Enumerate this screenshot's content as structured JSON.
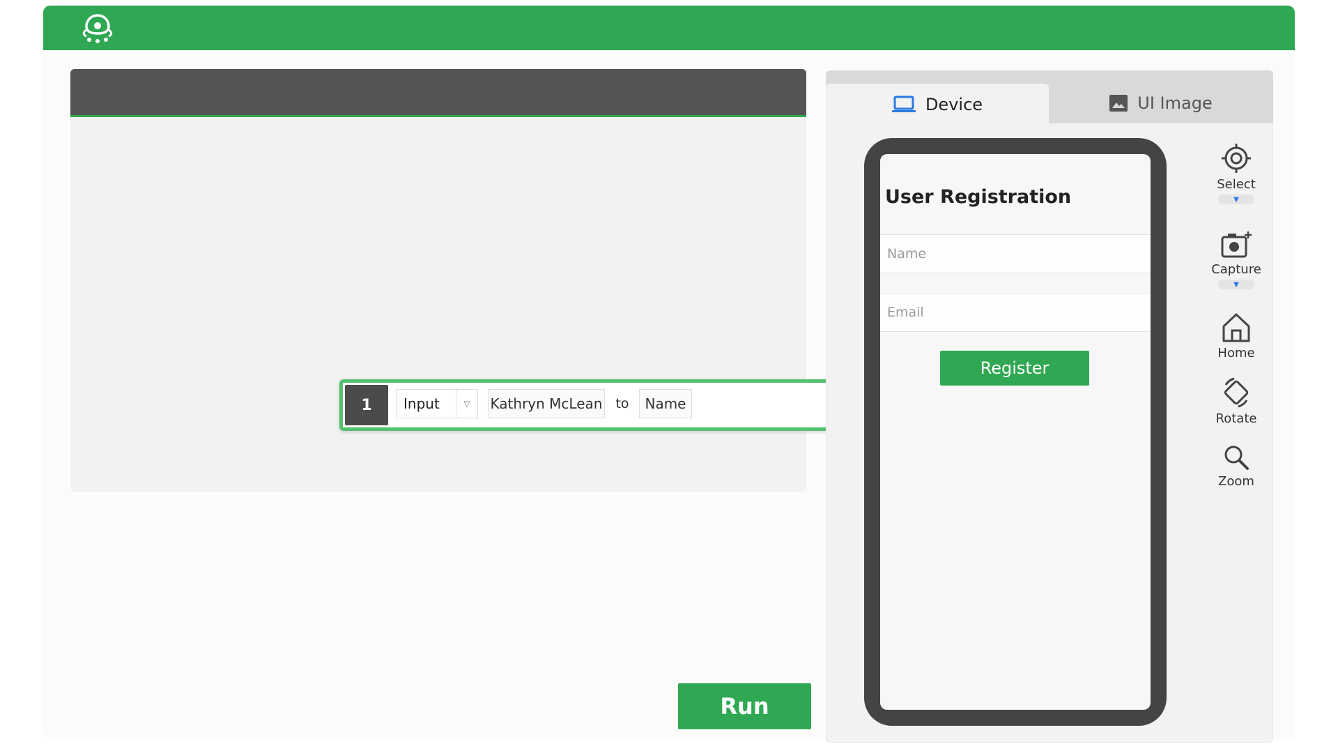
{
  "app": {
    "logo_icon": "robot-ufo-icon",
    "brand_color": "#30a853"
  },
  "step": {
    "number": "1",
    "action": "Input",
    "value": "Kathryn McLean",
    "connector": "to",
    "target": "Name"
  },
  "run_label": "Run",
  "tabs": {
    "device": {
      "label": "Device",
      "icon": "laptop-icon"
    },
    "ui_image": {
      "label": "UI Image",
      "icon": "image-icon"
    }
  },
  "device_screen": {
    "title": "User Registration",
    "name_placeholder": "Name",
    "email_placeholder": "Email",
    "register_label": "Register"
  },
  "tools": [
    {
      "label": "Select",
      "icon": "target-icon"
    },
    {
      "label": "Capture",
      "icon": "camera-icon"
    },
    {
      "label": "Home",
      "icon": "home-icon"
    },
    {
      "label": "Rotate",
      "icon": "rotate-icon"
    },
    {
      "label": "Zoom",
      "icon": "zoom-icon"
    }
  ]
}
